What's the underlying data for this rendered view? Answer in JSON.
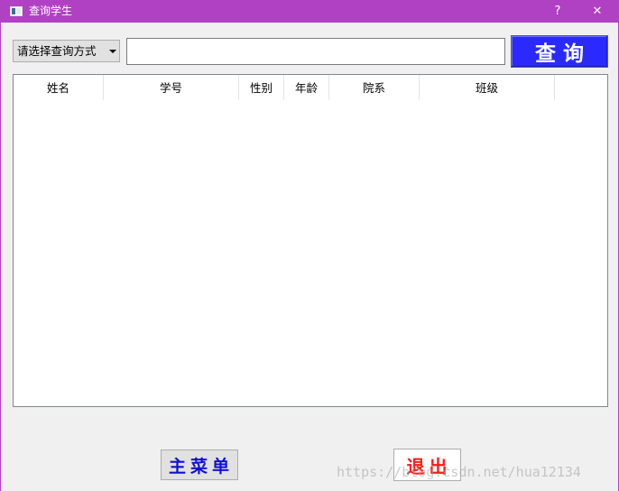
{
  "window": {
    "title": "查询学生",
    "help_label": "?",
    "close_label": "✕",
    "title_bar_color": "#b041c2"
  },
  "search": {
    "mode_selected": "请选择查询方式",
    "input_value": "",
    "input_placeholder": "",
    "query_button_label": "查询",
    "query_button_color": "#2a2aff"
  },
  "table": {
    "columns": [
      "姓名",
      "学号",
      "性别",
      "年龄",
      "院系",
      "班级"
    ],
    "rows": []
  },
  "footer": {
    "main_menu_label": "主菜单",
    "exit_label": "退出",
    "main_menu_color": "#1010d0",
    "exit_color": "#ff1a1a"
  },
  "watermark": "https://blog.csdn.net/hua12134",
  "icons": {
    "app": "window-app-icon",
    "help": "help-icon",
    "close": "close-icon",
    "dropdown": "chevron-down-icon"
  }
}
